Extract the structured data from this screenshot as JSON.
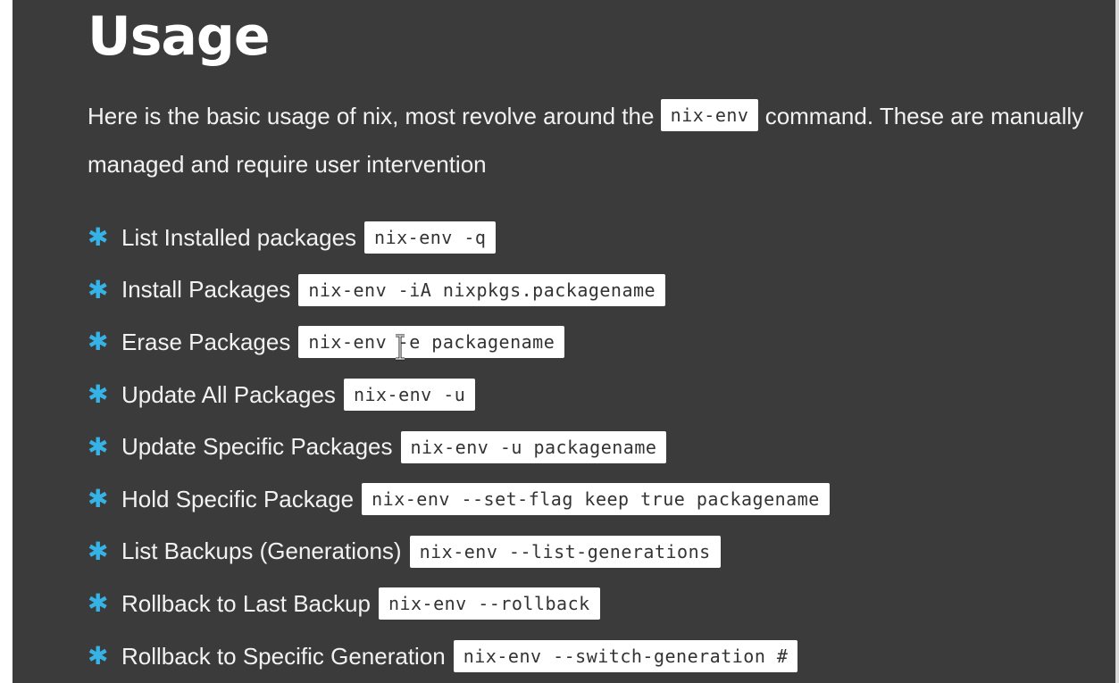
{
  "heading": "Usage",
  "intro": {
    "before": "Here is the basic usage of nix, most revolve around the ",
    "code": "nix-env",
    "after": " command. These are manually managed and require user intervention"
  },
  "bullet_glyph": "✱",
  "accent_color": "#35b3e6",
  "items": [
    {
      "label": "List Installed packages",
      "code": "nix-env -q"
    },
    {
      "label": "Install Packages",
      "code": "nix-env -iA nixpkgs.packagename"
    },
    {
      "label": "Erase Packages",
      "code": "nix-env -e packagename"
    },
    {
      "label": "Update All Packages",
      "code": "nix-env -u"
    },
    {
      "label": "Update Specific Packages",
      "code": "nix-env -u packagename"
    },
    {
      "label": "Hold Specific Package",
      "code": "nix-env --set-flag keep true packagename"
    },
    {
      "label": "List Backups (Generations)",
      "code": "nix-env --list-generations"
    },
    {
      "label": "Rollback to Last Backup",
      "code": "nix-env --rollback"
    },
    {
      "label": "Rollback to Specific Generation",
      "code": "nix-env --switch-generation #"
    }
  ],
  "cursor_icon": "text-cursor-icon"
}
